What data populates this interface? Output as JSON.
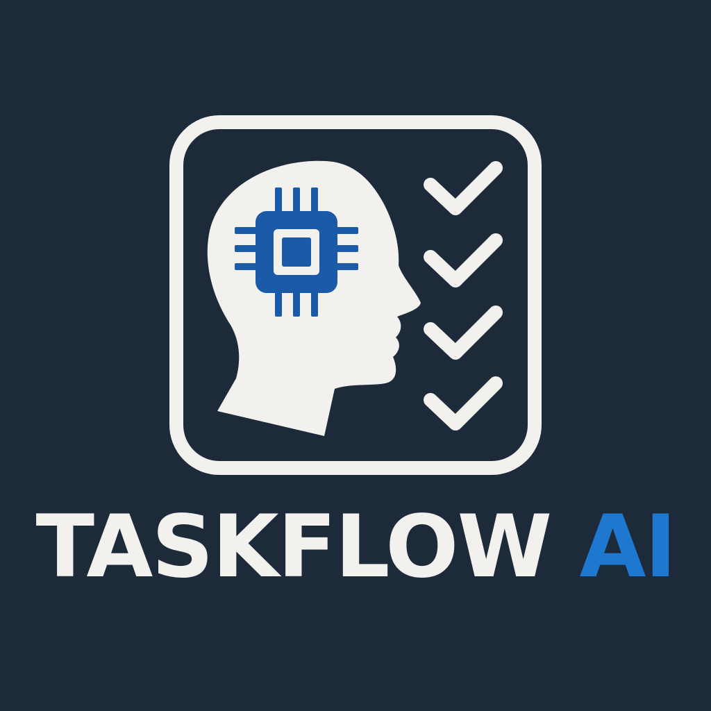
{
  "brand": {
    "name_primary": "TASKFLOW",
    "name_accent": "AI"
  },
  "colors": {
    "background": "#1d2a3a",
    "foreground": "#f2f1ee",
    "accent": "#1e78d0",
    "chip": "#1b5aa6"
  },
  "icons": [
    "rounded-frame",
    "head-silhouette-icon",
    "microchip-icon",
    "checkmark-icon"
  ],
  "checklist": {
    "count": 4
  }
}
